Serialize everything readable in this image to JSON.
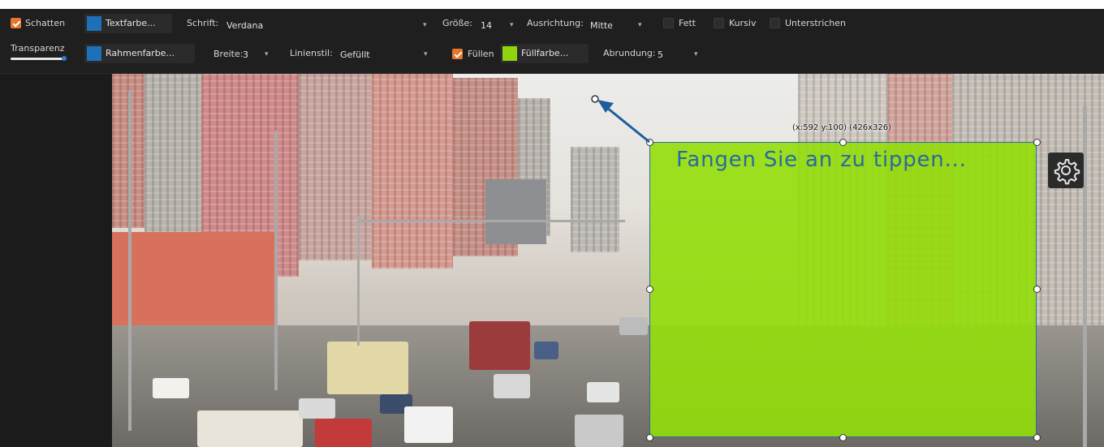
{
  "toolbar": {
    "shadow": {
      "label": "Schatten",
      "checked": true
    },
    "text_color_button": {
      "label": "Textfarbe...",
      "color": "#1e70b8"
    },
    "font": {
      "label": "Schrift:",
      "value": "Verdana"
    },
    "size": {
      "label": "Größe:",
      "value": "14"
    },
    "alignment": {
      "label": "Ausrichtung:",
      "value": "Mitte"
    },
    "bold": {
      "label": "Fett",
      "checked": false
    },
    "italic": {
      "label": "Kursiv",
      "checked": false
    },
    "underline": {
      "label": "Unterstrichen",
      "checked": false
    },
    "transparency": {
      "label": "Transparenz",
      "level": 1.0
    },
    "border_color_button": {
      "label": "Rahmenfarbe...",
      "color": "#1e70b8"
    },
    "width": {
      "label": "Breite:",
      "value": "3"
    },
    "line_style": {
      "label": "Linienstil:",
      "value": "Gefüllt"
    },
    "fill": {
      "label": "Füllen",
      "checked": true
    },
    "fill_color_button": {
      "label": "Füllfarbe...",
      "color": "#8fd40c"
    },
    "rounding": {
      "label": "Abrundung:",
      "value": "5"
    }
  },
  "canvas": {
    "text_placeholder": "Fangen Sie an zu tippen...",
    "selection_info": "(x:592 y:100) (426x326)",
    "settings_icon": "gear-icon",
    "accent_color": "#1e5e9e"
  }
}
